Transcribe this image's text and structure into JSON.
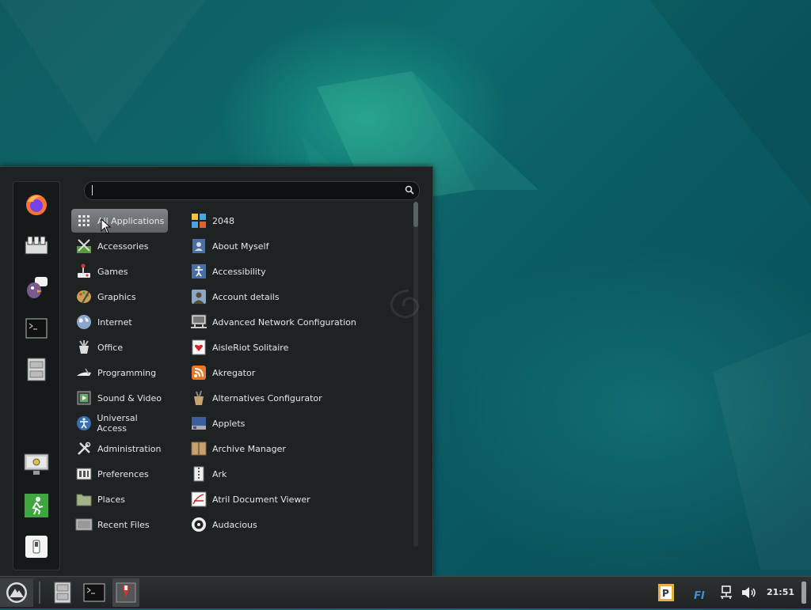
{
  "search": {
    "value": "",
    "placeholder": ""
  },
  "favorites": [
    {
      "name": "firefox-icon"
    },
    {
      "name": "software-manager-icon"
    },
    {
      "name": "pidgin-icon"
    },
    {
      "name": "terminal-icon"
    },
    {
      "name": "files-icon"
    }
  ],
  "session": [
    {
      "name": "lock-screen-icon"
    },
    {
      "name": "logout-icon"
    },
    {
      "name": "shutdown-icon"
    }
  ],
  "categories": [
    {
      "label": "All Applications",
      "icon": "grid-icon",
      "active": true
    },
    {
      "label": "Accessories",
      "icon": "accessories-icon"
    },
    {
      "label": "Games",
      "icon": "games-icon"
    },
    {
      "label": "Graphics",
      "icon": "graphics-icon"
    },
    {
      "label": "Internet",
      "icon": "internet-icon"
    },
    {
      "label": "Office",
      "icon": "office-icon"
    },
    {
      "label": "Programming",
      "icon": "programming-icon"
    },
    {
      "label": "Sound & Video",
      "icon": "sound-video-icon"
    },
    {
      "label": "Universal Access",
      "icon": "universal-access-icon"
    },
    {
      "label": "Administration",
      "icon": "administration-icon"
    },
    {
      "label": "Preferences",
      "icon": "preferences-icon"
    },
    {
      "label": "Places",
      "icon": "folder-icon"
    },
    {
      "label": "Recent Files",
      "icon": "recent-files-icon"
    }
  ],
  "apps": [
    {
      "label": "2048",
      "icon": "2048-icon"
    },
    {
      "label": "About Myself",
      "icon": "about-myself-icon"
    },
    {
      "label": "Accessibility",
      "icon": "accessibility-icon"
    },
    {
      "label": "Account details",
      "icon": "account-details-icon"
    },
    {
      "label": "Advanced Network Configuration",
      "icon": "network-config-icon"
    },
    {
      "label": "AisleRiot Solitaire",
      "icon": "solitaire-icon"
    },
    {
      "label": "Akregator",
      "icon": "rss-icon"
    },
    {
      "label": "Alternatives Configurator",
      "icon": "alternatives-icon"
    },
    {
      "label": "Applets",
      "icon": "applets-icon"
    },
    {
      "label": "Archive Manager",
      "icon": "archive-icon"
    },
    {
      "label": "Ark",
      "icon": "ark-icon"
    },
    {
      "label": "Atril Document Viewer",
      "icon": "document-viewer-icon"
    },
    {
      "label": "Audacious",
      "icon": "audacious-icon"
    }
  ],
  "panel": {
    "clock": "21:51",
    "keyboard_layout": "FI"
  },
  "colors": {
    "menu_bg": "#1e2223",
    "active_category": "#6e7476",
    "panel_bg": "#262b2c"
  }
}
